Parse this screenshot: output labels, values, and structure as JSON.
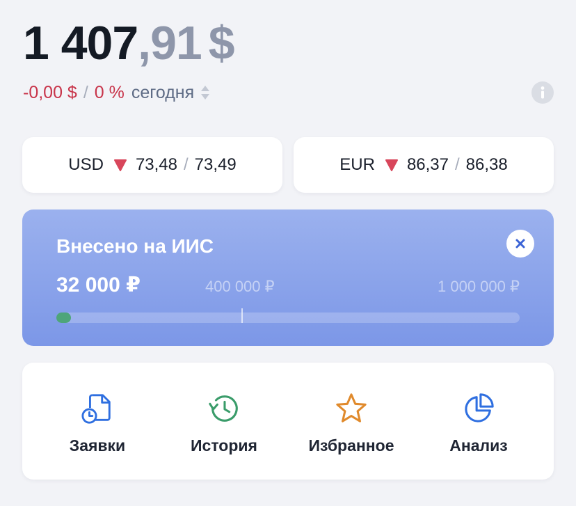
{
  "balance": {
    "integer": "1 407",
    "fraction": ",91",
    "currency": "$"
  },
  "change": {
    "amount": "-0,00 $",
    "separator": "/",
    "percent": "0 %",
    "period": "сегодня",
    "color": "#c8344a"
  },
  "currencies": [
    {
      "code": "USD",
      "direction": "down",
      "bid": "73,48",
      "separator": "/",
      "ask": "73,49"
    },
    {
      "code": "EUR",
      "direction": "down",
      "bid": "86,37",
      "separator": "/",
      "ask": "86,38"
    }
  ],
  "iis": {
    "title": "Внесено на ИИС",
    "amount": "32 000 ₽",
    "milestone": "400 000 ₽",
    "limit": "1 000 000 ₽",
    "progress_fraction": 0.032,
    "milestone_fraction": 0.4,
    "accent": "#4ea57a"
  },
  "actions": [
    {
      "label": "Заявки",
      "icon": "orders-clock-icon",
      "color": "#2f6fe0"
    },
    {
      "label": "История",
      "icon": "history-icon",
      "color": "#3a9c6a"
    },
    {
      "label": "Избранное",
      "icon": "star-icon",
      "color": "#e08a2c"
    },
    {
      "label": "Анализ",
      "icon": "pie-chart-icon",
      "color": "#2f6fe0"
    }
  ]
}
